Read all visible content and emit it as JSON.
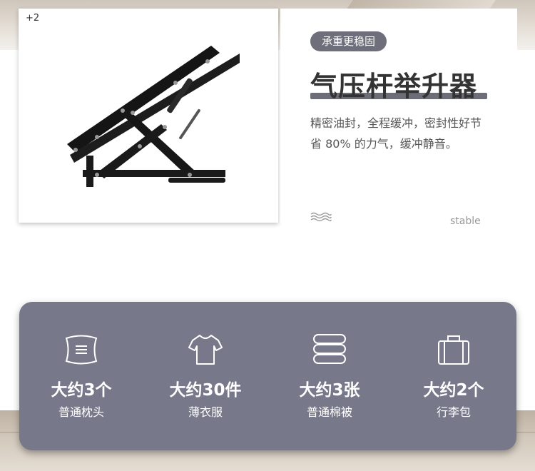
{
  "photo": {
    "plus_badge": "+2"
  },
  "info": {
    "tag": "承重更稳固",
    "title": "气压杆举升器",
    "description": "精密油封，全程缓冲，密封性好节省 80% 的力气，缓冲静音。",
    "footnote": "stable"
  },
  "features": [
    {
      "icon": "pillow-icon",
      "amount": "大约3个",
      "item": "普通枕头"
    },
    {
      "icon": "tshirt-icon",
      "amount": "大约30件",
      "item": "薄衣服"
    },
    {
      "icon": "quilt-stack-icon",
      "amount": "大约3张",
      "item": "普通棉被"
    },
    {
      "icon": "suitcase-icon",
      "amount": "大约2个",
      "item": "行李包"
    }
  ],
  "colors": {
    "accent": "#6f6f7b",
    "panel": "#77798a",
    "title": "#333333"
  }
}
